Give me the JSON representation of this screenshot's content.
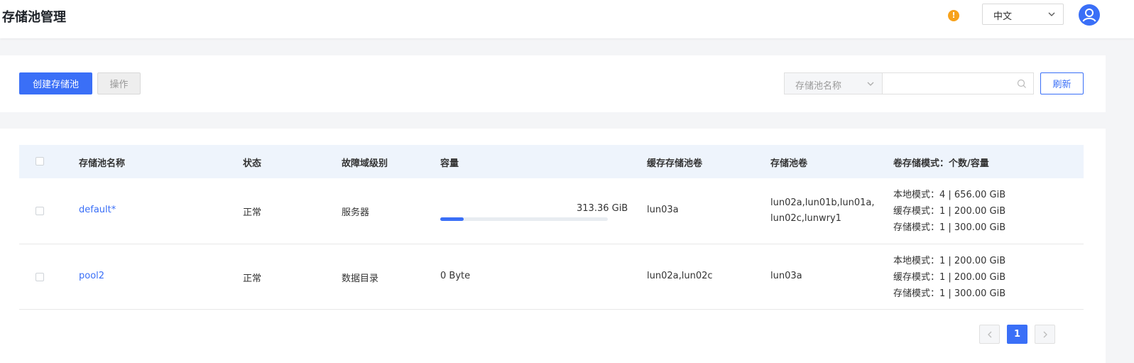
{
  "header": {
    "title": "存储池管理",
    "language": "中文",
    "warning_icon": "alert-circle-icon",
    "warning_glyph": "!",
    "avatar_icon": "user-avatar-icon",
    "accent_color": "#3a6ff7",
    "warning_color": "#f7a21b"
  },
  "toolbar": {
    "create_label": "创建存储池",
    "action_label": "操作",
    "filter_field": "存储池名称",
    "search_value": "",
    "refresh_label": "刷新"
  },
  "table": {
    "columns": [
      "存储池名称",
      "状态",
      "故障域级别",
      "容量",
      "缓存存储池卷",
      "存储池卷",
      "卷存储模式：个数/容量"
    ],
    "rows": [
      {
        "name": "default*",
        "status": "正常",
        "fault_domain": "服务器",
        "capacity": "313.36 GiB",
        "capacity_used_fraction": 0.14,
        "cache_volumes": "lun03a",
        "pool_volumes_line1": "lun02a,lun01b,lun01a,",
        "pool_volumes_line2": "lun02c,lunwry1",
        "mode_local": "本地模式：4 | 656.00 GiB",
        "mode_cache": "缓存模式：1 | 200.00 GiB",
        "mode_storage": "存储模式：1 | 300.00 GiB"
      },
      {
        "name": "pool2",
        "status": "正常",
        "fault_domain": "数据目录",
        "capacity": "0 Byte",
        "cache_volumes": "lun02a,lun02c",
        "pool_volumes_line1": "lun03a",
        "mode_local": "本地模式：1 | 200.00 GiB",
        "mode_cache": "缓存模式：1 | 200.00 GiB",
        "mode_storage": "存储模式：1 | 300.00 GiB"
      }
    ]
  },
  "pagination": {
    "current_page": "1"
  }
}
